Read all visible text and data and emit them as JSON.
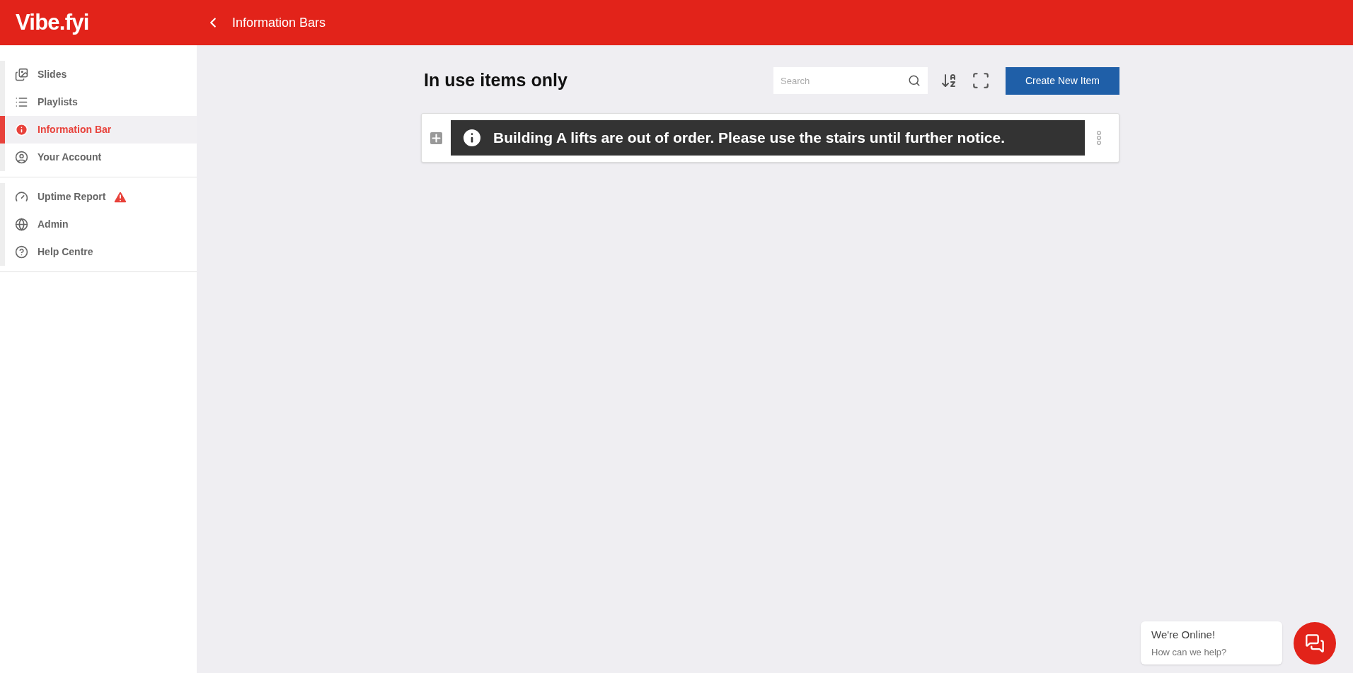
{
  "header": {
    "logo": "Vibe.fyi",
    "title": "Information Bars"
  },
  "sidebar": {
    "groups": [
      {
        "items": [
          {
            "label": "Slides",
            "selected": false,
            "warning": false
          },
          {
            "label": "Playlists",
            "selected": false,
            "warning": false
          },
          {
            "label": "Information Bar",
            "selected": true,
            "warning": false
          },
          {
            "label": "Your Account",
            "selected": false,
            "warning": false
          }
        ]
      },
      {
        "items": [
          {
            "label": "Uptime Report",
            "selected": false,
            "warning": true
          },
          {
            "label": "Admin",
            "selected": false,
            "warning": false
          },
          {
            "label": "Help Centre",
            "selected": false,
            "warning": false
          }
        ]
      }
    ]
  },
  "main": {
    "heading": "In use items only",
    "search": {
      "placeholder": "Search"
    },
    "create_button": "Create New Item",
    "items": [
      {
        "text": "Building A lifts are out of order. Please use the stairs until further notice."
      }
    ]
  },
  "chat": {
    "title": "We're Online!",
    "subtitle": "How can we help?"
  }
}
